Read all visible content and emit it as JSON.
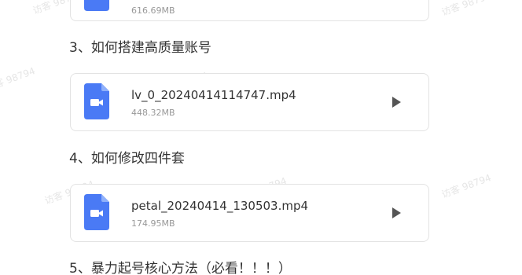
{
  "watermark_text": "访客 98794",
  "files": [
    {
      "name": "",
      "size": "616.69MB",
      "icon": "video-file-icon"
    },
    {
      "name": "lv_0_20240414114747.mp4",
      "size": "448.32MB",
      "icon": "video-file-icon"
    },
    {
      "name": "petal_20240414_130503.mp4",
      "size": "174.95MB",
      "icon": "video-file-icon"
    }
  ],
  "sections": [
    {
      "title": "3、如何搭建高质量账号"
    },
    {
      "title": "4、如何修改四件套"
    },
    {
      "title": "5、暴力起号核心方法（必看！！！）"
    }
  ],
  "colors": {
    "file_icon": "#4a7af5",
    "play_icon": "#555555",
    "card_border": "#e3e3e3",
    "watermark": "#e6e6e6"
  }
}
